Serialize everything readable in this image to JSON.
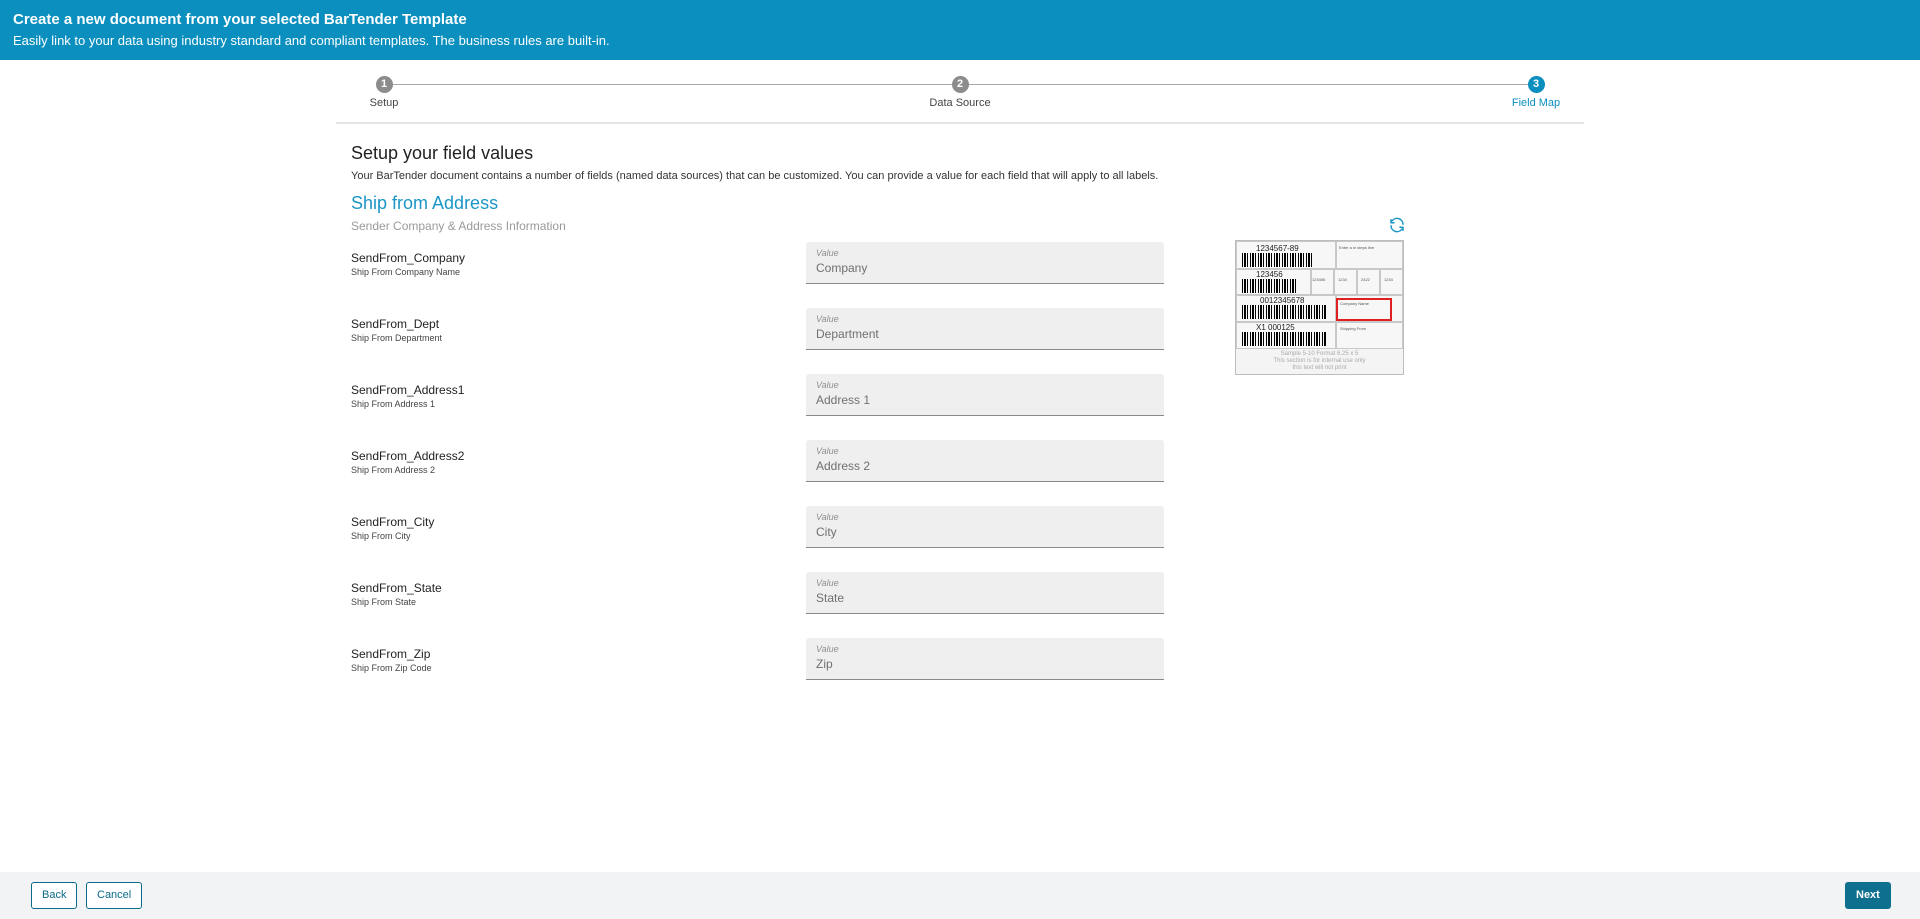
{
  "header": {
    "title": "Create a new document from your selected BarTender Template",
    "subtitle": "Easily link to your data using industry standard and compliant templates. The business rules are built-in."
  },
  "stepper": {
    "steps": [
      {
        "number": "1",
        "label": "Setup"
      },
      {
        "number": "2",
        "label": "Data Source"
      },
      {
        "number": "3",
        "label": "Field Map"
      }
    ]
  },
  "main": {
    "title": "Setup your field values",
    "description": "Your BarTender document contains a number of fields (named data sources) that can be customized. You can provide a value for each field that will apply to all labels.",
    "section_title": "Ship from Address",
    "section_subtitle": "Sender Company & Address Information"
  },
  "fields": [
    {
      "name": "SendFrom_Company",
      "description": "Ship From Company Name",
      "value_label": "Value",
      "placeholder": "Company"
    },
    {
      "name": "SendFrom_Dept",
      "description": "Ship From Department",
      "value_label": "Value",
      "placeholder": "Department"
    },
    {
      "name": "SendFrom_Address1",
      "description": "Ship From Address 1",
      "value_label": "Value",
      "placeholder": "Address 1"
    },
    {
      "name": "SendFrom_Address2",
      "description": "Ship From Address 2",
      "value_label": "Value",
      "placeholder": "Address 2"
    },
    {
      "name": "SendFrom_City",
      "description": "Ship From City",
      "value_label": "Value",
      "placeholder": "City"
    },
    {
      "name": "SendFrom_State",
      "description": "Ship From State",
      "value_label": "Value",
      "placeholder": "State"
    },
    {
      "name": "SendFrom_Zip",
      "description": "Ship From Zip Code",
      "value_label": "Value",
      "placeholder": "Zip"
    }
  ],
  "preview": {
    "numbers": [
      "1234567-89",
      "123456",
      "0012345678",
      "X1 000125",
      "123456",
      "1234",
      "2422",
      "1234"
    ],
    "notes": [
      "Enter a in steps line",
      "Company Name",
      "Shipping From",
      "Sample 5-10 Format 6.25 x 5",
      "This section is for internal use only",
      "this text will not print"
    ]
  },
  "icons": {
    "refresh": "refresh-icon"
  },
  "footer": {
    "back_label": "Back",
    "cancel_label": "Cancel",
    "next_label": "Next"
  },
  "colors": {
    "brand": "#0a8fbf",
    "accent_text": "#1b96c6",
    "primary_button": "#0f6f8f"
  }
}
